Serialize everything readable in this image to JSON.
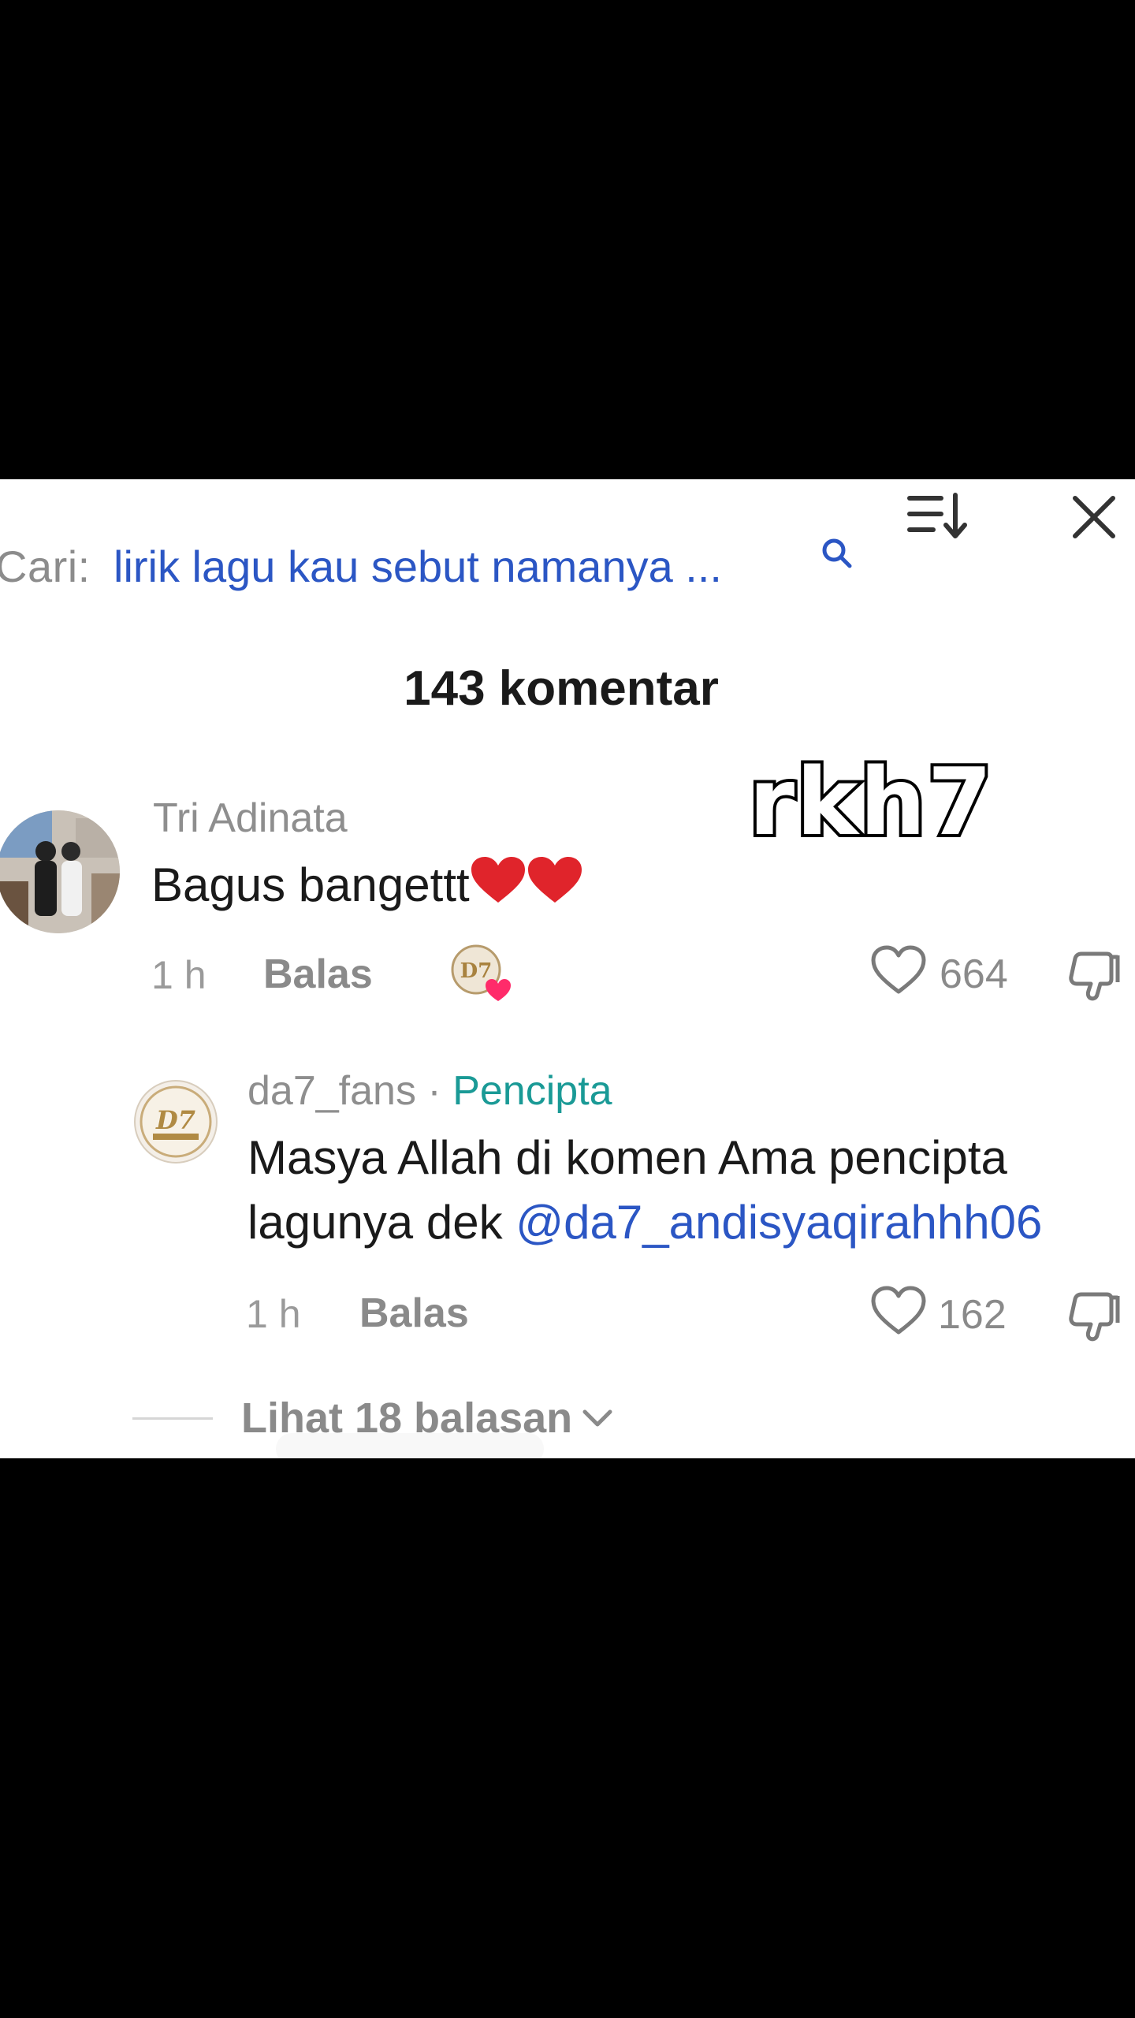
{
  "search": {
    "label": "Cari:",
    "query": "lirik lagu kau sebut namanya ..."
  },
  "header": {
    "comment_count": "143 komentar"
  },
  "watermark": "rkh7",
  "comments": [
    {
      "username": "Tri Adinata",
      "text": "Bagus bangettt",
      "time": "1 h",
      "reply_label": "Balas",
      "likes": "664"
    }
  ],
  "reply": {
    "username": "da7_fans",
    "separator": "·",
    "creator_label": "Pencipta",
    "text": "Masya Allah di komen Ama pencipta lagunya dek ",
    "mention": "@da7_andisyaqirahhh06",
    "time": "1 h",
    "reply_label": "Balas",
    "likes": "162"
  },
  "view_replies": "Lihat 18 balasan",
  "colors": {
    "link_blue": "#2b56c4",
    "creator_teal": "#1a9a96",
    "heart_red": "#e0242b"
  },
  "icons": [
    "search-icon",
    "sort-icon",
    "close-icon",
    "heart-icon",
    "dislike-icon",
    "chevron-down-icon"
  ]
}
